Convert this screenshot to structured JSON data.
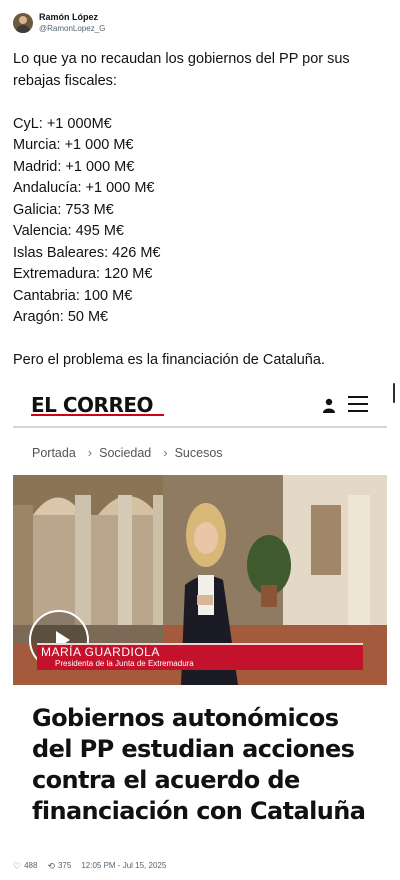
{
  "author": {
    "name": "Ramón López",
    "handle": "@RamonLopez_G"
  },
  "tweet": {
    "intro": "Lo que ya no recaudan los gobiernos del PP por sus rebajas fiscales:",
    "items": [
      "CyL: +1 000M€",
      "Murcia: +1 000 M€",
      "Madrid: +1 000 M€",
      "Andalucía: +1 000 M€",
      "Galicia: 753 M€",
      "Valencia: 495 M€",
      "Islas Baleares: 426 M€",
      "Extremadura: 120 M€",
      "Cantabria: 100 M€",
      "Aragón: 50 M€"
    ],
    "closing": "Pero el problema es la financiación de Cataluña."
  },
  "embed": {
    "brand": "EL CORREO",
    "brand_accent": "#d0021b",
    "breadcrumb": [
      "Portada",
      "Sociedad",
      "Sucesos"
    ],
    "video": {
      "name": "MARÍA GUARDIOLA",
      "role": "Presidenta de la Junta de Extremadura",
      "lower_third_color": "#c4122c"
    },
    "headline": "Gobiernos autonómicos del PP estudian acciones contra el acuerdo de financiación con Cataluña",
    "icons": [
      "user-icon",
      "menu-icon",
      "play-icon"
    ]
  },
  "footer": {
    "likes": "488",
    "retweets": "375",
    "timestamp": "12:05 PM - Jul 15, 2025"
  }
}
